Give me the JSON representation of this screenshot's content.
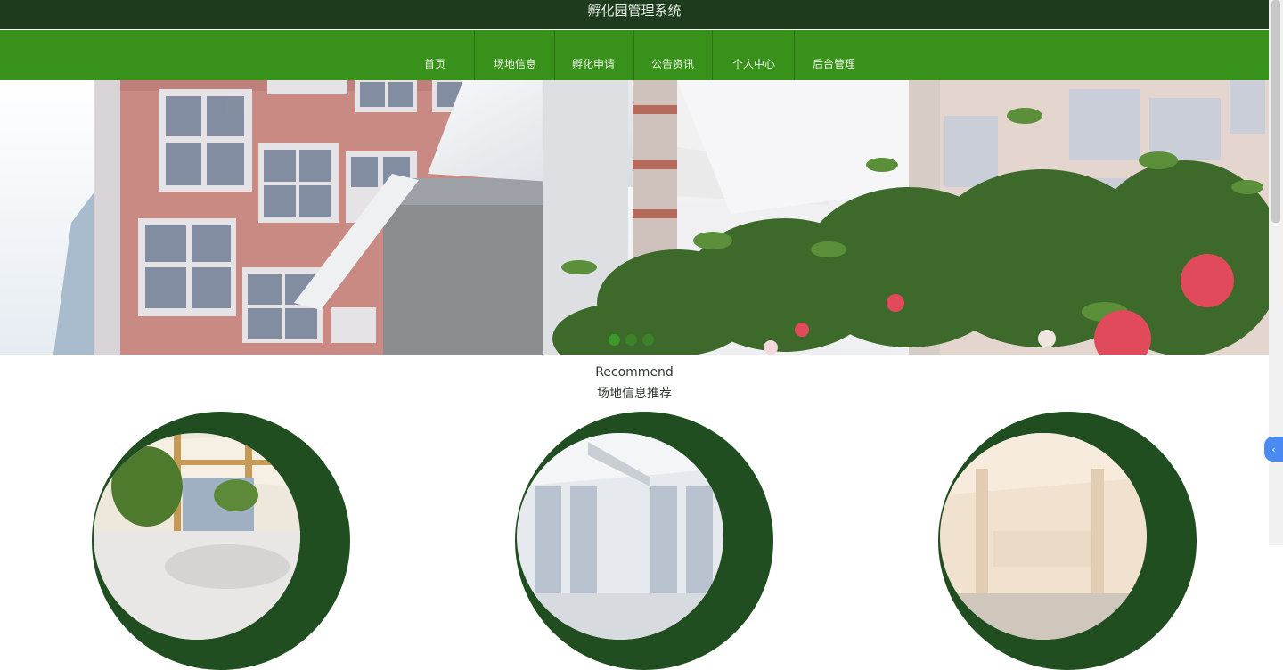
{
  "app": {
    "title": "孵化园管理系统"
  },
  "nav": {
    "items": [
      {
        "label": "首页"
      },
      {
        "label": "场地信息"
      },
      {
        "label": "孵化申请"
      },
      {
        "label": "公告资讯"
      },
      {
        "label": "个人中心"
      },
      {
        "label": "后台管理"
      }
    ]
  },
  "banner": {
    "slide_count": 3,
    "active_slide": 1
  },
  "recommend": {
    "title_en": "Recommend",
    "title_cn": "场地信息推荐",
    "card_count": 3
  },
  "widgets": {
    "float_button_icon": "chevron-left-icon",
    "float_button_glyph": "‹"
  },
  "colors": {
    "topbar": "#1e3b1e",
    "nav": "#38911a",
    "ring": "#204e20",
    "accent": "#4b8af2"
  }
}
